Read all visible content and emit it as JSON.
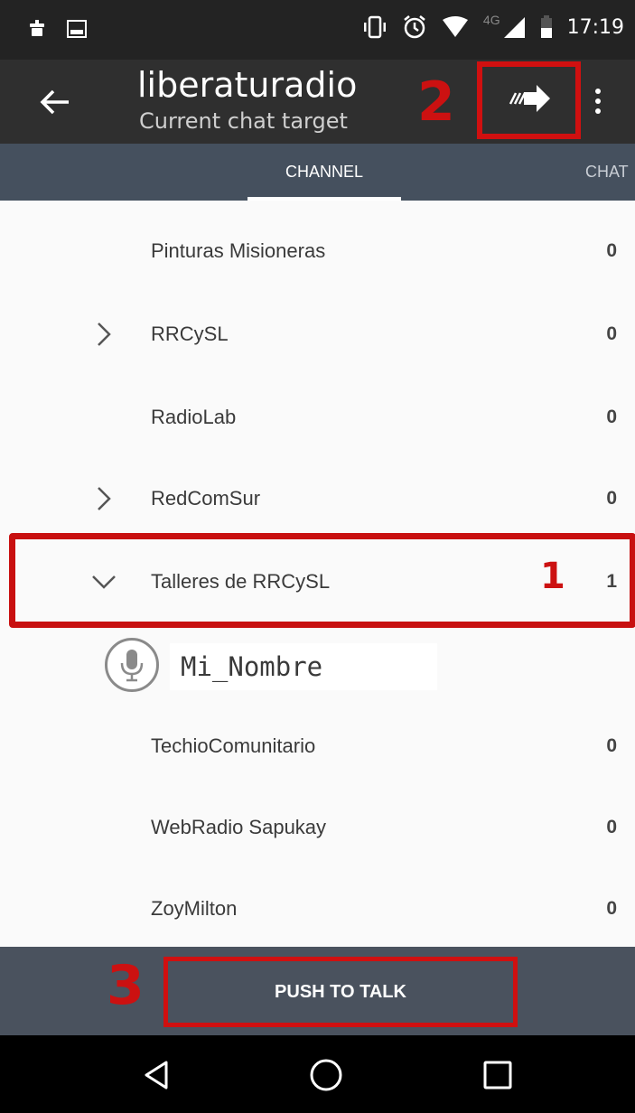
{
  "status_bar": {
    "time": "17:19",
    "network": "4G",
    "icons": [
      "notification-icon",
      "image-icon",
      "vibrate-icon",
      "alarm-icon",
      "wifi-icon",
      "signal-icon",
      "battery-icon"
    ]
  },
  "toolbar": {
    "title": "liberaturadio",
    "subtitle": "Current chat target",
    "icons": [
      "back-arrow-icon",
      "send-arrow-icon",
      "more-vert-icon"
    ]
  },
  "tabs": [
    {
      "label": "CHANNEL",
      "selected": true
    },
    {
      "label": "CHAT",
      "selected": false
    }
  ],
  "channels": [
    {
      "name": "Pinturas Misioneras",
      "count": "0",
      "expander": "none"
    },
    {
      "name": "RRCySL",
      "count": "0",
      "expander": "collapsed"
    },
    {
      "name": "RadioLab",
      "count": "0",
      "expander": "none"
    },
    {
      "name": "RedComSur",
      "count": "0",
      "expander": "collapsed"
    },
    {
      "name": "Talleres de RRCySL",
      "count": "1",
      "expander": "expanded"
    },
    {
      "name": "TechioComunitario",
      "count": "0",
      "expander": "none"
    },
    {
      "name": "WebRadio Sapukay",
      "count": "0",
      "expander": "none"
    },
    {
      "name": "ZoyMilton",
      "count": "0",
      "expander": "none"
    }
  ],
  "user": {
    "name": "Mi_Nombre",
    "icon": "microphone-icon"
  },
  "annotations": {
    "marker_1": "1",
    "marker_2": "2",
    "marker_3": "3",
    "color": "#cc1111"
  },
  "push_to_talk": {
    "label": "PUSH TO TALK"
  },
  "nav_bar": {
    "icons": [
      "nav-back-icon",
      "nav-home-icon",
      "nav-recents-icon"
    ]
  },
  "colors": {
    "status_bar": "#232323",
    "toolbar": "#2f2f2f",
    "tabs": "#45505e",
    "ptt_bar": "#4a525e",
    "highlight": "#c81010"
  }
}
